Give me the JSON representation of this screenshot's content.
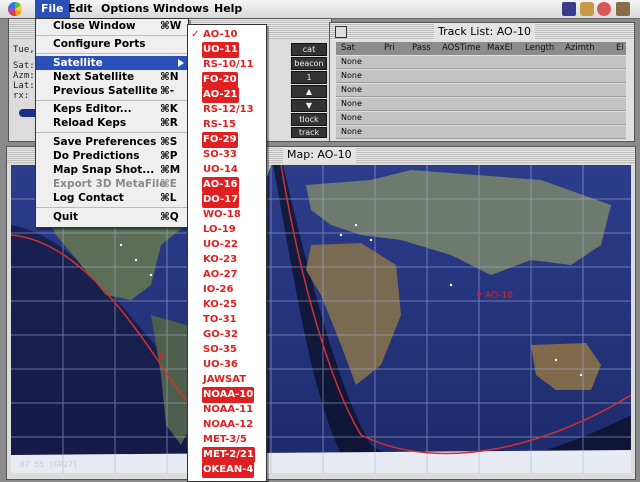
{
  "menubar": {
    "items": [
      "File",
      "Edit",
      "Options",
      "Windows",
      "Help"
    ]
  },
  "main_window": {
    "line1": "Tue,",
    "line2": [
      "Sat:",
      "Azm:",
      "Lat:",
      "rx:"
    ],
    "buttons": [
      "cat",
      "beacon",
      "1",
      "tlock",
      "track"
    ]
  },
  "track_list": {
    "title": "Track List: AO-10",
    "columns": [
      "Sat",
      "Pri",
      "Pass",
      "AOSTime",
      "MaxEl",
      "Length",
      "Azimth",
      "El"
    ],
    "rows": [
      "None",
      "None",
      "None",
      "None",
      "None",
      "None"
    ]
  },
  "map_window": {
    "title": "Map: AO-10",
    "status": "87   55 [GR27]",
    "sat_label": "AO-10"
  },
  "file_menu": {
    "items": [
      {
        "label": "Close Window",
        "key": "⌘W"
      },
      {
        "label": "Configure Ports",
        "key": ""
      },
      {
        "label": "Satellite",
        "key": ""
      },
      {
        "label": "Next Satellite",
        "key": "⌘N"
      },
      {
        "label": "Previous Satellite",
        "key": "⌘-"
      },
      {
        "label": "Keps Editor...",
        "key": "⌘K"
      },
      {
        "label": "Reload Keps",
        "key": "⌘R"
      },
      {
        "label": "Save Preferences",
        "key": "⌘S"
      },
      {
        "label": "Do Predictions",
        "key": "⌘P"
      },
      {
        "label": "Map Snap Shot...",
        "key": "⌘M"
      },
      {
        "label": "Export 3D MetaFile",
        "key": "⌘E"
      },
      {
        "label": "Log Contact",
        "key": "⌘L"
      },
      {
        "label": "Quit",
        "key": "⌘Q"
      }
    ]
  },
  "satellite_menu": {
    "checked": "AO-10",
    "items": [
      {
        "name": "AO-10",
        "style": "red"
      },
      {
        "name": "UO-11",
        "style": "hl"
      },
      {
        "name": "RS-10/11",
        "style": "red"
      },
      {
        "name": "FO-20",
        "style": "hl"
      },
      {
        "name": "AO-21",
        "style": "hl"
      },
      {
        "name": "RS-12/13",
        "style": "red"
      },
      {
        "name": "RS-15",
        "style": "red"
      },
      {
        "name": "FO-29",
        "style": "hl"
      },
      {
        "name": "SO-33",
        "style": "red"
      },
      {
        "name": "UO-14",
        "style": "red"
      },
      {
        "name": "AO-16",
        "style": "hl"
      },
      {
        "name": "DO-17",
        "style": "hl"
      },
      {
        "name": "WO-18",
        "style": "red"
      },
      {
        "name": "LO-19",
        "style": "red"
      },
      {
        "name": "UO-22",
        "style": "red"
      },
      {
        "name": "KO-23",
        "style": "red"
      },
      {
        "name": "AO-27",
        "style": "red"
      },
      {
        "name": "IO-26",
        "style": "red"
      },
      {
        "name": "KO-25",
        "style": "red"
      },
      {
        "name": "TO-31",
        "style": "red"
      },
      {
        "name": "GO-32",
        "style": "red"
      },
      {
        "name": "SO-35",
        "style": "red"
      },
      {
        "name": "UO-36",
        "style": "red"
      },
      {
        "name": "JAWSAT",
        "style": "red"
      },
      {
        "name": "NOAA-10",
        "style": "hl"
      },
      {
        "name": "NOAA-11",
        "style": "red"
      },
      {
        "name": "NOAA-12",
        "style": "red"
      },
      {
        "name": "MET-3/5",
        "style": "red"
      },
      {
        "name": "MET-2/21",
        "style": "hl"
      },
      {
        "name": "OKEAN-4",
        "style": "hl"
      }
    ]
  }
}
